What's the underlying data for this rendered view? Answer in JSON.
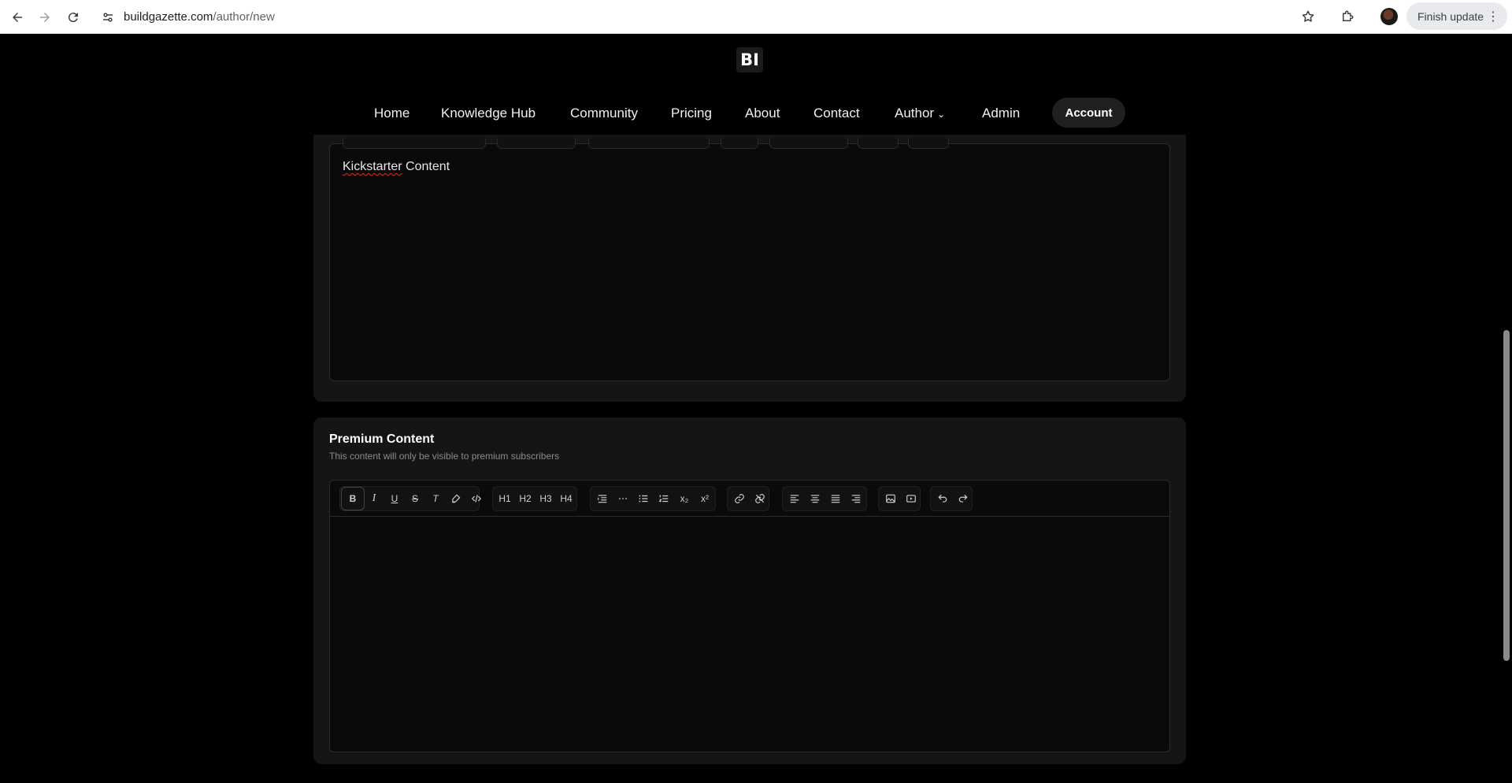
{
  "browser": {
    "url_domain": "buildgazette.com",
    "url_path": "/author/new",
    "finish_update_label": "Finish update"
  },
  "site": {
    "logo_text": "BI",
    "nav": [
      {
        "label": "Home"
      },
      {
        "label": "Knowledge Hub"
      },
      {
        "label": "Community"
      },
      {
        "label": "Pricing"
      },
      {
        "label": "About"
      },
      {
        "label": "Contact"
      },
      {
        "label": "Author"
      },
      {
        "label": "Admin"
      }
    ],
    "account_label": "Account"
  },
  "editor_top": {
    "content_word1": "Kickstarter",
    "content_word2": " Content"
  },
  "premium": {
    "title": "Premium Content",
    "subtitle": "This content will only be visible to premium subscribers",
    "toolbar": {
      "bold": "B",
      "italic": "I",
      "underline": "U",
      "strike": "S",
      "clear_format": "T",
      "h1": "H1",
      "h2": "H2",
      "h3": "H3",
      "h4": "H4",
      "subscript": "x₂",
      "superscript": "x²"
    }
  }
}
